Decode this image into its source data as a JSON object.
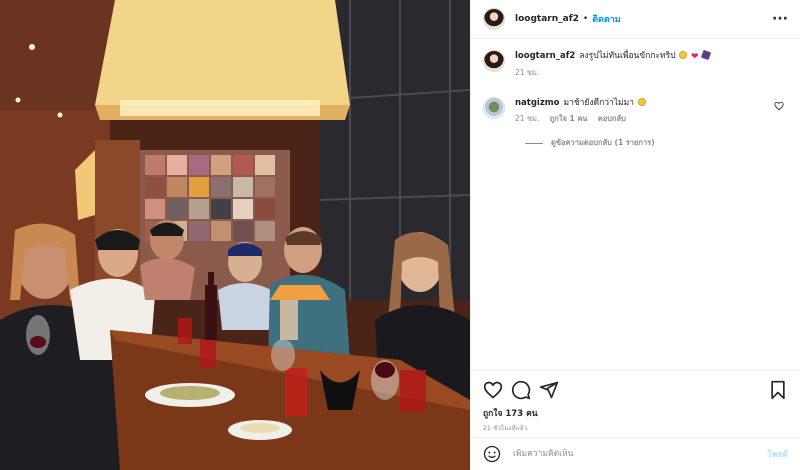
{
  "post": {
    "author": "loogtarn_af2",
    "separator": "•",
    "follow_label": "ติดตาม",
    "more_label": "···",
    "caption": {
      "username": "loogtarn_af2",
      "text": "ลงรูปไม่ทันเพื่อนขักกะทริป",
      "time": "21 ชม."
    },
    "comments": [
      {
        "username": "natgizmo",
        "text": "มาช้ายังดีกว่าไม่มา",
        "time": "21 ชม.",
        "likes": "ถูกใจ 1 คน",
        "reply_label": "ตอบกลับ"
      }
    ],
    "view_replies": "ดูข้อความตอบกลับ (1 รายการ)",
    "likes_text": "ถูกใจ 173 คน",
    "timestamp": "21 ชั่วโมงที่แล้ว",
    "add_comment_placeholder": "เพิ่มความคิดเห็น",
    "post_button": "โพสต์"
  },
  "icons": {
    "like": "heart-icon",
    "comment": "comment-icon",
    "share": "share-icon",
    "save": "bookmark-icon",
    "emoji": "smile-icon"
  },
  "colors": {
    "accent": "#0095f6",
    "accent_disabled": "#b2dffc",
    "muted": "#8e8e8e",
    "text": "#262626"
  }
}
